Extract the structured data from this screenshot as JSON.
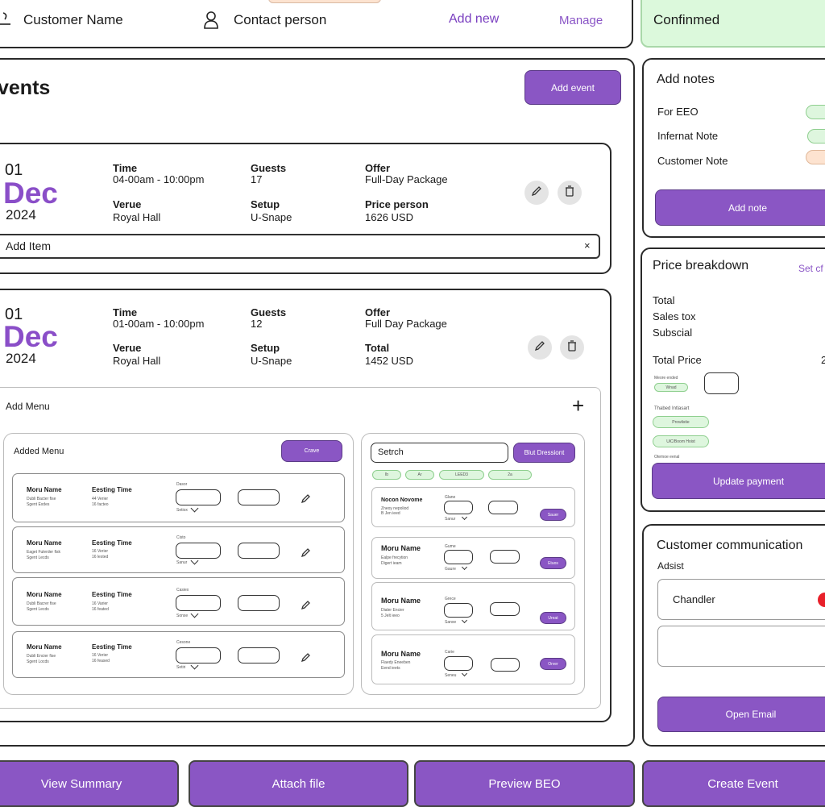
{
  "header": {
    "customer_name": "Customer Name",
    "contact_person": "Contact person",
    "add_new": "Add new",
    "manage": "Manage",
    "status": "Confinmed"
  },
  "events_panel": {
    "title": "vents",
    "add_event": "Add event",
    "event1": {
      "day": "01",
      "month": "Dec",
      "year": "2024",
      "time_label": "Time",
      "time": "04-00am - 10:00pm",
      "guests_label": "Guests",
      "guests": "17",
      "offer_label": "Offer",
      "offer": "Full-Day Package",
      "venue_label": "Verue",
      "venue": "Royal Hall",
      "setup_label": "Setup",
      "setup": "U-Snape",
      "price_label": "Price person",
      "price": "1626 USD",
      "add_item": "Add Item",
      "add_item_close": "×"
    },
    "event2": {
      "day": "01",
      "month": "Dec",
      "year": "2024",
      "time_label": "Time",
      "time": "01-00am - 10:00pm",
      "guests_label": "Guests",
      "guests": "12",
      "offer_label": "Offer",
      "offer": "Full Day Package",
      "venue_label": "Verue",
      "venue": "Royal Hall",
      "setup_label": "Setup",
      "setup": "U-Snape",
      "total_label": "Total",
      "total": "1452 USD"
    },
    "menu": {
      "title": "Add Menu",
      "plus": "+",
      "added_menu": {
        "title": "Added Menu",
        "button": "Crave",
        "rows": [
          {
            "name": "Moru Name",
            "desc1": "Dubli Bacter fise",
            "desc2": "Sgent Exdes",
            "time_label": "Eesting Time",
            "t1": "44 Verier",
            "t2": "16 facteo",
            "field_label": "Dasor",
            "sel": "Setiox"
          },
          {
            "name": "Moru Name",
            "desc1": "Eaget Fulerder fisk",
            "desc2": "Sgent Lecds",
            "time_label": "Eesting Time",
            "t1": "16 Verier",
            "t2": "16 lested",
            "field_label": "Cisto",
            "sel": "Sanur"
          },
          {
            "name": "Moru Name",
            "desc1": "Dubli Bacrer fise",
            "desc2": "Sgent Lecds",
            "time_label": "Eesting Time",
            "t1": "16 Varier",
            "t2": "16 feated",
            "field_label": "Casiex",
            "sel": "Sonxe"
          },
          {
            "name": "Moru Name",
            "desc1": "Dubli Encier fise",
            "desc2": "Sgent Locds",
            "time_label": "Eesting Time",
            "t1": "16 Verier",
            "t2": "16 feased",
            "field_label": "Cesone",
            "sel": "Setiri"
          }
        ]
      },
      "search": {
        "value": "Setrch",
        "button": "Blut Dressiont",
        "chips": [
          "Ib",
          "Ar",
          "LEED3",
          "2a"
        ],
        "rows": [
          {
            "name": "Nocon Novome",
            "desc1": "Zneoy nepoliod",
            "desc2": "B Jen ieed",
            "label": "Glane",
            "sel": "Sanur",
            "action": "Sauer"
          },
          {
            "name": "Moru Name",
            "desc1": "Ealpe frecytion",
            "desc2": "Digert ieam",
            "label": "Gume",
            "sel": "Gaure",
            "action": "Etuos"
          },
          {
            "name": "Moru Name",
            "desc1": "Dialer Encier",
            "desc2": "5 Jelt ieeo",
            "label": "Grece",
            "sel": "Sanxe",
            "action": "Ureat"
          },
          {
            "name": "Moru Name",
            "desc1": "Flaedy Eneeben",
            "desc2": "Eend ieets",
            "label": "Carie",
            "sel": "Seneu",
            "action": "Orver"
          }
        ]
      }
    }
  },
  "notes": {
    "title": "Add notes",
    "items": [
      "For EEO",
      "Infernat Note",
      "Customer Note"
    ],
    "add_note": "Add note"
  },
  "price": {
    "title": "Price breakdown",
    "link": "Set cf",
    "lines": [
      "Total",
      "Sales tox",
      "Subscial"
    ],
    "total_price": "Total Price",
    "total_price_value": "2",
    "method_label": "Meore ended",
    "method_pill": "Wnad",
    "tb_label": "Thabed Intlasart",
    "pill2": "Prowlistie",
    "pill3": "UiC/Boom Hoist",
    "status_label": "Otemoe eenal",
    "update": "Update payment"
  },
  "comm": {
    "title": "Customer communication",
    "label": "Adsist",
    "name": "Chandler",
    "open_email": "Open Email"
  },
  "footer": {
    "view_summary": "View Summary",
    "attach_file": "Attach file",
    "preview_beo": "Preview BEO",
    "create_event": "Create Event"
  },
  "colors": {
    "accent": "#8a56c4",
    "confirmed_bg": "#dcf9dc",
    "purple_text": "#8a4ec8",
    "pill_green": "#def6de",
    "pill_peach": "#fde3d0",
    "red_dot": "#e8202a"
  }
}
